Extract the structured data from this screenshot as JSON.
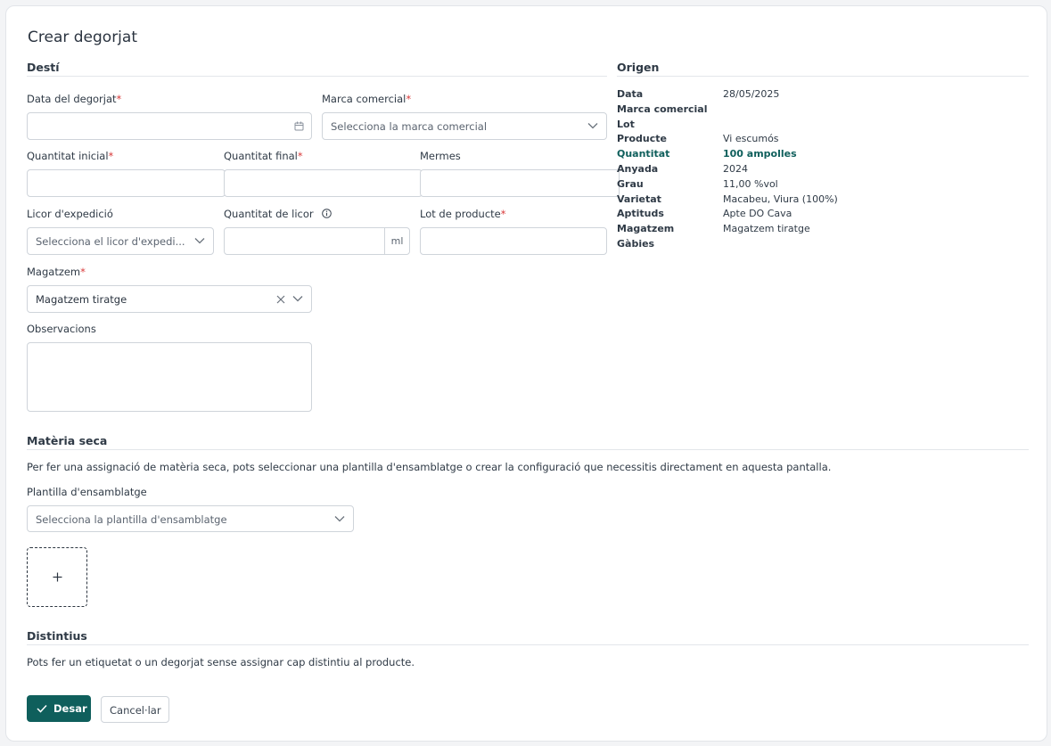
{
  "page": {
    "title": "Crear degorjat"
  },
  "desti": {
    "heading": "Destí",
    "data_degorjat": {
      "label": "Data del degorjat",
      "required": "*",
      "value": ""
    },
    "marca": {
      "label": "Marca comercial",
      "required": "*",
      "placeholder": "Selecciona la marca comercial"
    },
    "qty_inicial": {
      "label": "Quantitat inicial",
      "required": "*"
    },
    "qty_final": {
      "label": "Quantitat final",
      "required": "*"
    },
    "mermes": {
      "label": "Mermes"
    },
    "licor": {
      "label": "Licor d'expedició",
      "placeholder": "Selecciona el licor d'expedi..."
    },
    "qty_licor": {
      "label": "Quantitat de licor",
      "unit": "ml"
    },
    "lot": {
      "label": "Lot de producte",
      "required": "*"
    },
    "magatzem": {
      "label": "Magatzem",
      "required": "*",
      "value": "Magatzem tiratge"
    },
    "observacions": {
      "label": "Observacions"
    }
  },
  "origen": {
    "heading": "Origen",
    "rows": [
      {
        "key": "Data",
        "value": "28/05/2025"
      },
      {
        "key": "Marca comercial",
        "value": ""
      },
      {
        "key": "Lot",
        "value": ""
      },
      {
        "key": "Producte",
        "value": "Vi escumós"
      },
      {
        "key": "Quantitat",
        "value": "100 ampolles"
      },
      {
        "key": "Anyada",
        "value": "2024"
      },
      {
        "key": "Grau",
        "value": "11,00 %vol"
      },
      {
        "key": "Varietat",
        "value": "Macabeu, Viura (100%)"
      },
      {
        "key": "Aptituds",
        "value": "Apte DO Cava"
      },
      {
        "key": "Magatzem",
        "value": "Magatzem tiratge"
      },
      {
        "key": "Gàbies",
        "value": ""
      }
    ]
  },
  "materia": {
    "heading": "Matèria seca",
    "description": "Per fer una assignació de matèria seca, pots seleccionar una plantilla d'ensamblatge o crear la configuració que necessitis directament en aquesta pantalla.",
    "plantilla_label": "Plantilla d'ensamblatge",
    "plantilla_placeholder": "Selecciona la plantilla d'ensamblatge",
    "add_symbol": "+"
  },
  "distintius": {
    "heading": "Distintius",
    "description": "Pots fer un etiquetat o un degorjat sense assignar cap distintiu al producte."
  },
  "actions": {
    "save": "Desar",
    "cancel": "Cancel·lar"
  },
  "colors": {
    "accent": "#0f5f5c",
    "required": "#d93a3a",
    "border": "#cfd4da"
  },
  "icons": [
    "calendar-icon",
    "chevron-down-icon",
    "clear-icon",
    "info-icon",
    "check-icon",
    "plus-icon"
  ]
}
